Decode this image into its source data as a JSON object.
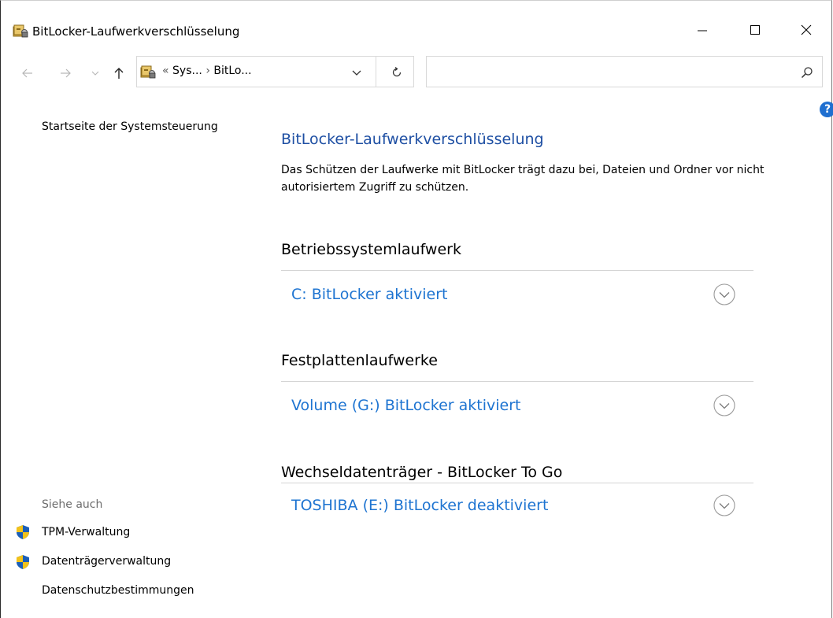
{
  "window": {
    "title": "BitLocker-Laufwerkverschlüsselung",
    "icon": "bitlocker-icon"
  },
  "navigation": {
    "address_segments": [
      "«",
      "Sys...",
      "›",
      "BitLo..."
    ],
    "search_placeholder": ""
  },
  "left_pane": {
    "home_link": "Startseite der Systemsteuerung",
    "see_also_label": "Siehe auch",
    "links": [
      {
        "label": "TPM-Verwaltung",
        "icon": "uac-shield-icon"
      },
      {
        "label": "Datenträgerverwaltung",
        "icon": "uac-shield-icon"
      },
      {
        "label": "Datenschutzbestimmungen",
        "icon": ""
      }
    ]
  },
  "main": {
    "title": "BitLocker-Laufwerkverschlüsselung",
    "description": "Das Schützen der Laufwerke mit BitLocker trägt dazu bei, Dateien und Ordner vor nicht autorisiertem Zugriff zu schützen.",
    "sections": [
      {
        "heading": "Betriebssystemlaufwerk",
        "drives": [
          {
            "label": "C: BitLocker aktiviert"
          }
        ]
      },
      {
        "heading": "Festplattenlaufwerke",
        "drives": [
          {
            "label": "Volume (G:) BitLocker aktiviert"
          }
        ]
      },
      {
        "heading": "Wechseldatenträger - BitLocker To Go",
        "drives": [
          {
            "label": "TOSHIBA (E:) BitLocker deaktiviert"
          }
        ]
      }
    ]
  },
  "colors": {
    "title_blue": "#1e4fa3",
    "link_blue": "#1e74d1",
    "help_blue": "#1f6fd0",
    "shield_blue": "#1c5fb8",
    "shield_yellow": "#f2c21b"
  }
}
